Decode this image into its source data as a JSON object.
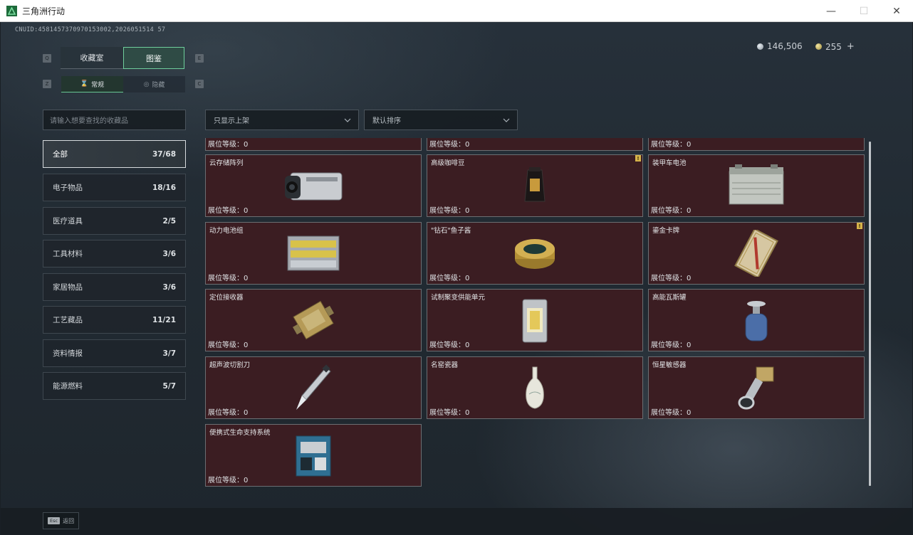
{
  "window": {
    "title": "三角洲行动",
    "minimize": "—",
    "maximize": "☐",
    "close": "✕"
  },
  "uid": "CNUID:4581457370970153002,2026051514 57",
  "currency": {
    "silver": "146,506",
    "gold": "255",
    "plus": "+"
  },
  "keys": {
    "q": "Q",
    "e": "E",
    "z": "Z",
    "c": "C"
  },
  "tabs": {
    "collection": "收藏室",
    "catalog": "图鉴"
  },
  "subtabs": {
    "normal": "常规",
    "secret": "隐藏"
  },
  "search": {
    "placeholder": "请输入想要查找的收藏品"
  },
  "filters": {
    "shelf": "只显示上架",
    "sort": "默认排序"
  },
  "categories": [
    {
      "label": "全部",
      "count": "37/68"
    },
    {
      "label": "电子物品",
      "count": "18/16"
    },
    {
      "label": "医疗道具",
      "count": "2/5"
    },
    {
      "label": "工具材料",
      "count": "3/6"
    },
    {
      "label": "家居物品",
      "count": "3/6"
    },
    {
      "label": "工艺藏品",
      "count": "11/21"
    },
    {
      "label": "资料情报",
      "count": "3/7"
    },
    {
      "label": "能源燃料",
      "count": "5/7"
    }
  ],
  "items": [
    {
      "name": "",
      "level": "展位等级：0",
      "icon": "partial-item"
    },
    {
      "name": "",
      "level": "展位等级：0",
      "icon": "partial-item"
    },
    {
      "name": "",
      "level": "展位等级：0",
      "icon": "partial-item"
    },
    {
      "name": "云存储阵列",
      "level": "展位等级：0",
      "icon": "server-array-icon"
    },
    {
      "name": "高级咖啡豆",
      "level": "展位等级：0",
      "icon": "coffee-bag-icon",
      "badge": "!"
    },
    {
      "name": "装甲车电池",
      "level": "展位等级：0",
      "icon": "car-battery-icon"
    },
    {
      "name": "动力电池组",
      "level": "展位等级：0",
      "icon": "battery-pack-icon"
    },
    {
      "name": "\"钻石\"鱼子酱",
      "level": "展位等级：0",
      "icon": "caviar-tin-icon"
    },
    {
      "name": "鎏金卡牌",
      "level": "展位等级：0",
      "icon": "gilded-card-icon",
      "badge": "!"
    },
    {
      "name": "定位接收器",
      "level": "展位等级：0",
      "icon": "gps-receiver-icon"
    },
    {
      "name": "试制聚变供能单元",
      "level": "展位等级：0",
      "icon": "fusion-cell-icon"
    },
    {
      "name": "高能瓦斯罐",
      "level": "展位等级：0",
      "icon": "gas-canister-icon"
    },
    {
      "name": "超声波切割刀",
      "level": "展位等级：0",
      "icon": "ultrasonic-knife-icon"
    },
    {
      "name": "名窑瓷器",
      "level": "展位等级：0",
      "icon": "porcelain-vase-icon"
    },
    {
      "name": "恒星敏感器",
      "level": "展位等级：0",
      "icon": "star-sensor-icon"
    },
    {
      "name": "便携式生命支持系统",
      "level": "展位等级：0",
      "icon": "life-support-icon"
    }
  ],
  "bottom": {
    "esc_key": "Esc",
    "back": "返回"
  },
  "colors": {
    "card_bg": "#3b1d22",
    "accent": "#6fcf9c",
    "badge": "#d5b34a"
  }
}
